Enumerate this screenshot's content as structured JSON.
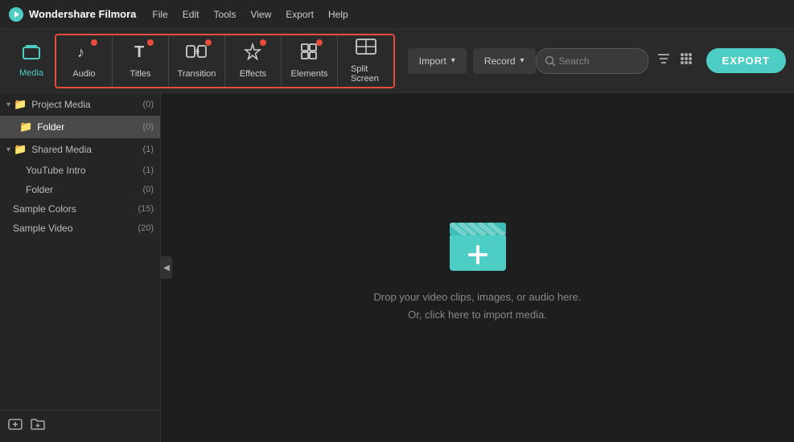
{
  "app": {
    "brand": "Wondershare Filmora",
    "export_label": "EXPORT"
  },
  "menu": {
    "items": [
      "File",
      "Edit",
      "Tools",
      "View",
      "Export",
      "Help"
    ]
  },
  "toolbar": {
    "media_label": "Media",
    "tabs": [
      {
        "id": "audio",
        "label": "Audio",
        "icon": "♪",
        "has_badge": true
      },
      {
        "id": "titles",
        "label": "Titles",
        "icon": "T",
        "has_badge": true
      },
      {
        "id": "transition",
        "label": "Transition",
        "icon": "⇄",
        "has_badge": true
      },
      {
        "id": "effects",
        "label": "Effects",
        "icon": "✦",
        "has_badge": true
      },
      {
        "id": "elements",
        "label": "Elements",
        "icon": "⊞",
        "has_badge": true
      },
      {
        "id": "split_screen",
        "label": "Split Screen",
        "icon": "▣",
        "has_badge": false
      }
    ],
    "import_label": "Import",
    "record_label": "Record",
    "search_placeholder": "Search",
    "filter_icon": "filter",
    "grid_icon": "grid"
  },
  "sidebar": {
    "project_media": {
      "label": "Project Media",
      "count": "(0)"
    },
    "folder": {
      "label": "Folder",
      "count": "(0)"
    },
    "shared_media": {
      "label": "Shared Media",
      "count": "(1)"
    },
    "youtube_intro": {
      "label": "YouTube Intro",
      "count": "(1)"
    },
    "shared_folder": {
      "label": "Folder",
      "count": "(0)"
    },
    "sample_colors": {
      "label": "Sample Colors",
      "count": "(15)"
    },
    "sample_video": {
      "label": "Sample Video",
      "count": "(20)"
    }
  },
  "content": {
    "drop_line1": "Drop your video clips, images, or audio here.",
    "drop_line2": "Or, click here to import media."
  },
  "colors": {
    "accent": "#4ecdc4",
    "badge": "#e74c3c",
    "border_highlight": "#e74c3c"
  }
}
